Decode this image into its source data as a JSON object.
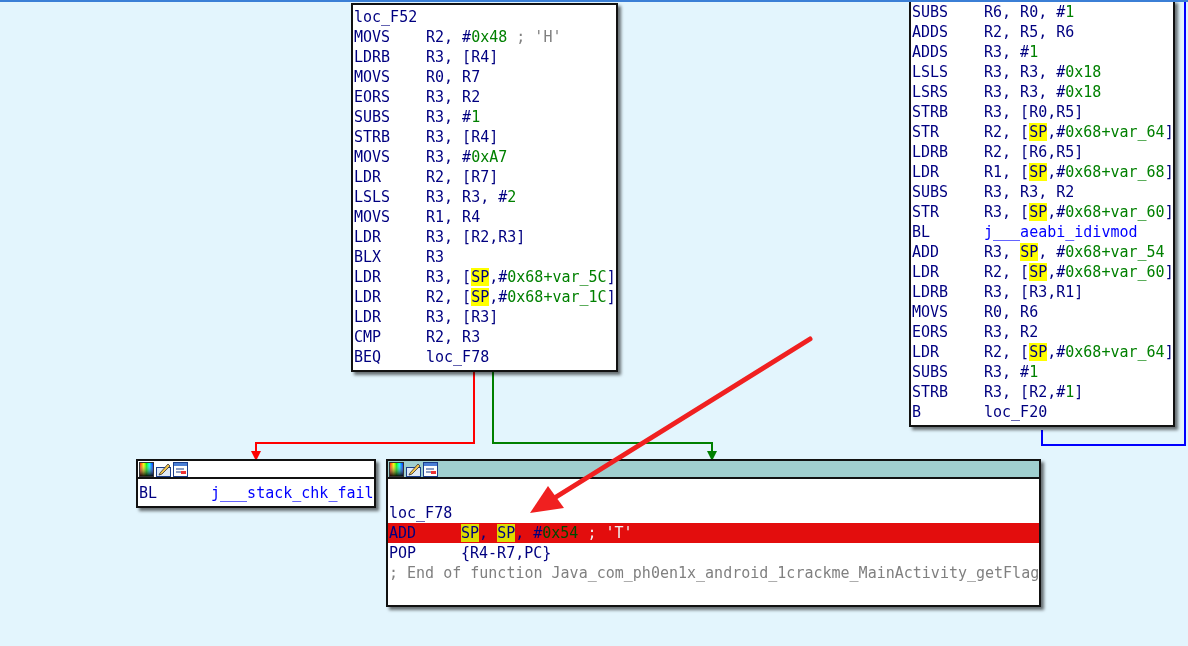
{
  "blocks": [
    {
      "header": false,
      "selected": false,
      "lines": [
        {
          "kind": "label",
          "text": "loc_F52",
          "selected": false
        },
        {
          "kind": "insn",
          "mnemonic": "MOVS",
          "selected": false,
          "operands": [
            {
              "kind": "plain",
              "text": "R2, #"
            },
            {
              "kind": "num",
              "text": "0x48"
            },
            {
              "kind": "comment",
              "text": " ; 'H'"
            }
          ]
        },
        {
          "kind": "insn",
          "mnemonic": "LDRB",
          "selected": false,
          "operands": [
            {
              "kind": "plain",
              "text": "R3, [R4]"
            }
          ]
        },
        {
          "kind": "insn",
          "mnemonic": "MOVS",
          "selected": false,
          "operands": [
            {
              "kind": "plain",
              "text": "R0, R7"
            }
          ]
        },
        {
          "kind": "insn",
          "mnemonic": "EORS",
          "selected": false,
          "operands": [
            {
              "kind": "plain",
              "text": "R3, R2"
            }
          ]
        },
        {
          "kind": "insn",
          "mnemonic": "SUBS",
          "selected": false,
          "operands": [
            {
              "kind": "plain",
              "text": "R3, #"
            },
            {
              "kind": "num",
              "text": "1"
            }
          ]
        },
        {
          "kind": "insn",
          "mnemonic": "STRB",
          "selected": false,
          "operands": [
            {
              "kind": "plain",
              "text": "R3, [R4]"
            }
          ]
        },
        {
          "kind": "insn",
          "mnemonic": "MOVS",
          "selected": false,
          "operands": [
            {
              "kind": "plain",
              "text": "R3, #"
            },
            {
              "kind": "num",
              "text": "0xA7"
            }
          ]
        },
        {
          "kind": "insn",
          "mnemonic": "LDR",
          "selected": false,
          "operands": [
            {
              "kind": "plain",
              "text": "R2, [R7]"
            }
          ]
        },
        {
          "kind": "insn",
          "mnemonic": "LSLS",
          "selected": false,
          "operands": [
            {
              "kind": "plain",
              "text": "R3, R3, #"
            },
            {
              "kind": "num",
              "text": "2"
            }
          ]
        },
        {
          "kind": "insn",
          "mnemonic": "MOVS",
          "selected": false,
          "operands": [
            {
              "kind": "plain",
              "text": "R1, R4"
            }
          ]
        },
        {
          "kind": "insn",
          "mnemonic": "LDR",
          "selected": false,
          "operands": [
            {
              "kind": "plain",
              "text": "R3, [R2,R3]"
            }
          ]
        },
        {
          "kind": "insn",
          "mnemonic": "BLX",
          "selected": false,
          "operands": [
            {
              "kind": "plain",
              "text": "R3"
            }
          ]
        },
        {
          "kind": "insn",
          "mnemonic": "LDR",
          "selected": false,
          "operands": [
            {
              "kind": "plain",
              "text": "R3, ["
            },
            {
              "kind": "sp",
              "text": "SP"
            },
            {
              "kind": "plain",
              "text": ",#"
            },
            {
              "kind": "num",
              "text": "0x68+var_5C"
            },
            {
              "kind": "plain",
              "text": "]"
            }
          ]
        },
        {
          "kind": "insn",
          "mnemonic": "LDR",
          "selected": false,
          "operands": [
            {
              "kind": "plain",
              "text": "R2, ["
            },
            {
              "kind": "sp",
              "text": "SP"
            },
            {
              "kind": "plain",
              "text": ",#"
            },
            {
              "kind": "num",
              "text": "0x68+var_1C"
            },
            {
              "kind": "plain",
              "text": "]"
            }
          ]
        },
        {
          "kind": "insn",
          "mnemonic": "LDR",
          "selected": false,
          "operands": [
            {
              "kind": "plain",
              "text": "R3, [R3]"
            }
          ]
        },
        {
          "kind": "insn",
          "mnemonic": "CMP",
          "selected": false,
          "operands": [
            {
              "kind": "plain",
              "text": "R2, R3"
            }
          ]
        },
        {
          "kind": "insn",
          "mnemonic": "BEQ",
          "selected": false,
          "operands": [
            {
              "kind": "plain",
              "text": "loc_F78"
            }
          ]
        }
      ]
    },
    {
      "header": false,
      "selected": false,
      "lines": [
        {
          "kind": "insn",
          "mnemonic": "SUBS",
          "selected": false,
          "operands": [
            {
              "kind": "plain",
              "text": "R6, R0, #"
            },
            {
              "kind": "num",
              "text": "1"
            }
          ]
        },
        {
          "kind": "insn",
          "mnemonic": "ADDS",
          "selected": false,
          "operands": [
            {
              "kind": "plain",
              "text": "R2, R5, R6"
            }
          ]
        },
        {
          "kind": "insn",
          "mnemonic": "ADDS",
          "selected": false,
          "operands": [
            {
              "kind": "plain",
              "text": "R3, #"
            },
            {
              "kind": "num",
              "text": "1"
            }
          ]
        },
        {
          "kind": "insn",
          "mnemonic": "LSLS",
          "selected": false,
          "operands": [
            {
              "kind": "plain",
              "text": "R3, R3, #"
            },
            {
              "kind": "num",
              "text": "0x18"
            }
          ]
        },
        {
          "kind": "insn",
          "mnemonic": "LSRS",
          "selected": false,
          "operands": [
            {
              "kind": "plain",
              "text": "R3, R3, #"
            },
            {
              "kind": "num",
              "text": "0x18"
            }
          ]
        },
        {
          "kind": "insn",
          "mnemonic": "STRB",
          "selected": false,
          "operands": [
            {
              "kind": "plain",
              "text": "R3, [R0,R5]"
            }
          ]
        },
        {
          "kind": "insn",
          "mnemonic": "STR",
          "selected": false,
          "operands": [
            {
              "kind": "plain",
              "text": "R2, ["
            },
            {
              "kind": "sp",
              "text": "SP"
            },
            {
              "kind": "plain",
              "text": ",#"
            },
            {
              "kind": "num",
              "text": "0x68+var_64"
            },
            {
              "kind": "plain",
              "text": "]"
            }
          ]
        },
        {
          "kind": "insn",
          "mnemonic": "LDRB",
          "selected": false,
          "operands": [
            {
              "kind": "plain",
              "text": "R2, [R6,R5]"
            }
          ]
        },
        {
          "kind": "insn",
          "mnemonic": "LDR",
          "selected": false,
          "operands": [
            {
              "kind": "plain",
              "text": "R1, ["
            },
            {
              "kind": "sp",
              "text": "SP"
            },
            {
              "kind": "plain",
              "text": ",#"
            },
            {
              "kind": "num",
              "text": "0x68+var_68"
            },
            {
              "kind": "plain",
              "text": "]"
            }
          ]
        },
        {
          "kind": "insn",
          "mnemonic": "SUBS",
          "selected": false,
          "operands": [
            {
              "kind": "plain",
              "text": "R3, R3, R2"
            }
          ]
        },
        {
          "kind": "insn",
          "mnemonic": "STR",
          "selected": false,
          "operands": [
            {
              "kind": "plain",
              "text": "R3, ["
            },
            {
              "kind": "sp",
              "text": "SP"
            },
            {
              "kind": "plain",
              "text": ",#"
            },
            {
              "kind": "num",
              "text": "0x68+var_60"
            },
            {
              "kind": "plain",
              "text": "]"
            }
          ]
        },
        {
          "kind": "insn",
          "mnemonic": "BL",
          "selected": false,
          "operands": [
            {
              "kind": "ref",
              "text": "j___aeabi_idivmod"
            }
          ]
        },
        {
          "kind": "insn",
          "mnemonic": "ADD",
          "selected": false,
          "operands": [
            {
              "kind": "plain",
              "text": "R3, "
            },
            {
              "kind": "sp",
              "text": "SP"
            },
            {
              "kind": "plain",
              "text": ", #"
            },
            {
              "kind": "num",
              "text": "0x68+var_54"
            }
          ]
        },
        {
          "kind": "insn",
          "mnemonic": "LDR",
          "selected": false,
          "operands": [
            {
              "kind": "plain",
              "text": "R2, ["
            },
            {
              "kind": "sp",
              "text": "SP"
            },
            {
              "kind": "plain",
              "text": ",#"
            },
            {
              "kind": "num",
              "text": "0x68+var_60"
            },
            {
              "kind": "plain",
              "text": "]"
            }
          ]
        },
        {
          "kind": "insn",
          "mnemonic": "LDRB",
          "selected": false,
          "operands": [
            {
              "kind": "plain",
              "text": "R3, [R3,R1]"
            }
          ]
        },
        {
          "kind": "insn",
          "mnemonic": "MOVS",
          "selected": false,
          "operands": [
            {
              "kind": "plain",
              "text": "R0, R6"
            }
          ]
        },
        {
          "kind": "insn",
          "mnemonic": "EORS",
          "selected": false,
          "operands": [
            {
              "kind": "plain",
              "text": "R3, R2"
            }
          ]
        },
        {
          "kind": "insn",
          "mnemonic": "LDR",
          "selected": false,
          "operands": [
            {
              "kind": "plain",
              "text": "R2, ["
            },
            {
              "kind": "sp",
              "text": "SP"
            },
            {
              "kind": "plain",
              "text": ",#"
            },
            {
              "kind": "num",
              "text": "0x68+var_64"
            },
            {
              "kind": "plain",
              "text": "]"
            }
          ]
        },
        {
          "kind": "insn",
          "mnemonic": "SUBS",
          "selected": false,
          "operands": [
            {
              "kind": "plain",
              "text": "R3, #"
            },
            {
              "kind": "num",
              "text": "1"
            }
          ]
        },
        {
          "kind": "insn",
          "mnemonic": "STRB",
          "selected": false,
          "operands": [
            {
              "kind": "plain",
              "text": "R3, [R2,#"
            },
            {
              "kind": "num",
              "text": "1"
            },
            {
              "kind": "plain",
              "text": "]"
            }
          ]
        },
        {
          "kind": "insn",
          "mnemonic": "B",
          "selected": false,
          "operands": [
            {
              "kind": "plain",
              "text": "loc_F20"
            }
          ]
        }
      ]
    },
    {
      "header": true,
      "selected": false,
      "lines": [
        {
          "kind": "insn",
          "mnemonic": "BL",
          "selected": false,
          "operands": [
            {
              "kind": "ref",
              "text": "j___stack_chk_fail"
            }
          ]
        }
      ]
    },
    {
      "header": true,
      "selected": true,
      "lines": [
        {
          "kind": "blank",
          "selected": false
        },
        {
          "kind": "label",
          "text": "loc_F78",
          "selected": false
        },
        {
          "kind": "insn",
          "mnemonic": "ADD",
          "selected": true,
          "operands": [
            {
              "kind": "sp",
              "text": "SP"
            },
            {
              "kind": "plain",
              "text": ", "
            },
            {
              "kind": "sp",
              "text": "SP"
            },
            {
              "kind": "plain",
              "text": ", #"
            },
            {
              "kind": "num",
              "text": "0x54"
            },
            {
              "kind": "comment",
              "text": " ; 'T'"
            }
          ]
        },
        {
          "kind": "insn",
          "mnemonic": "POP",
          "selected": false,
          "operands": [
            {
              "kind": "plain",
              "text": "{R4-R7,PC}"
            }
          ]
        },
        {
          "kind": "comment",
          "text": "; End of function Java_com_ph0en1x_android_1crackme_MainActivity_getFlag",
          "selected": false
        }
      ]
    }
  ],
  "edges": [
    {
      "color": "#ff0000"
    },
    {
      "color": "#008000"
    },
    {
      "color": "#0000ff"
    }
  ]
}
